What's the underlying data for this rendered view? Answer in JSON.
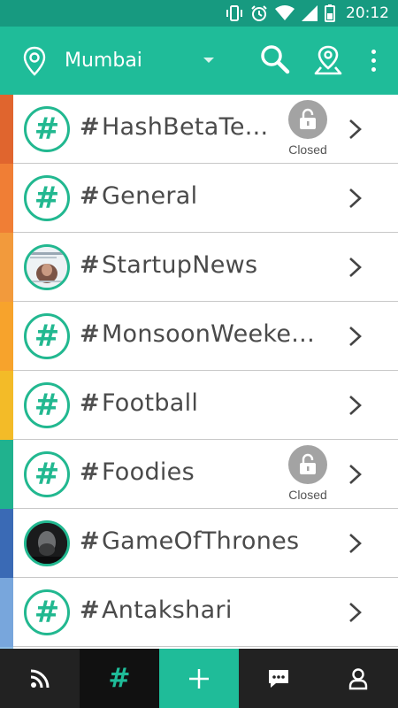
{
  "status_bar": {
    "time": "20:12",
    "icons": [
      "vibrate-icon",
      "alarm-icon",
      "wifi-icon",
      "signal-icon",
      "battery-icon"
    ]
  },
  "app_bar": {
    "city": "Mumbai",
    "icons": [
      "location-pin-icon",
      "dropdown-arrow-icon",
      "search-icon",
      "map-pin-icon",
      "overflow-menu-icon"
    ]
  },
  "colors": {
    "app_bar": "#1fbc99",
    "status_bar": "#179a80",
    "accent": "#22b890",
    "nav_background": "#222222",
    "lock_gray": "#a3a3a3"
  },
  "channels": [
    {
      "name": "HashBetaTe...",
      "stripe": "#e0652e",
      "avatar": "hashtag-icon",
      "status": "Closed"
    },
    {
      "name": "General",
      "stripe": "#f07e35",
      "avatar": "hashtag-icon",
      "status": ""
    },
    {
      "name": "StartupNews",
      "stripe": "#f29a3c",
      "avatar": "news-photo",
      "status": ""
    },
    {
      "name": "MonsoonWeeke...",
      "stripe": "#f7a32c",
      "avatar": "hashtag-icon",
      "status": ""
    },
    {
      "name": "Football",
      "stripe": "#f3bb28",
      "avatar": "hashtag-icon",
      "status": ""
    },
    {
      "name": "Foodies",
      "stripe": "#20b28e",
      "avatar": "hashtag-icon",
      "status": "Closed"
    },
    {
      "name": "GameOfThrones",
      "stripe": "#3a6ab5",
      "avatar": "portrait-photo",
      "status": ""
    },
    {
      "name": "Antakshari",
      "stripe": "#78a6dc",
      "avatar": "hashtag-icon",
      "status": ""
    },
    {
      "name": "",
      "stripe": "#8fbfe6",
      "avatar": "",
      "status": ""
    }
  ],
  "bottom_nav": {
    "items": [
      "feed-icon",
      "hashtag-icon",
      "add-icon",
      "chat-icon",
      "profile-icon"
    ],
    "active": "hashtag-icon"
  }
}
